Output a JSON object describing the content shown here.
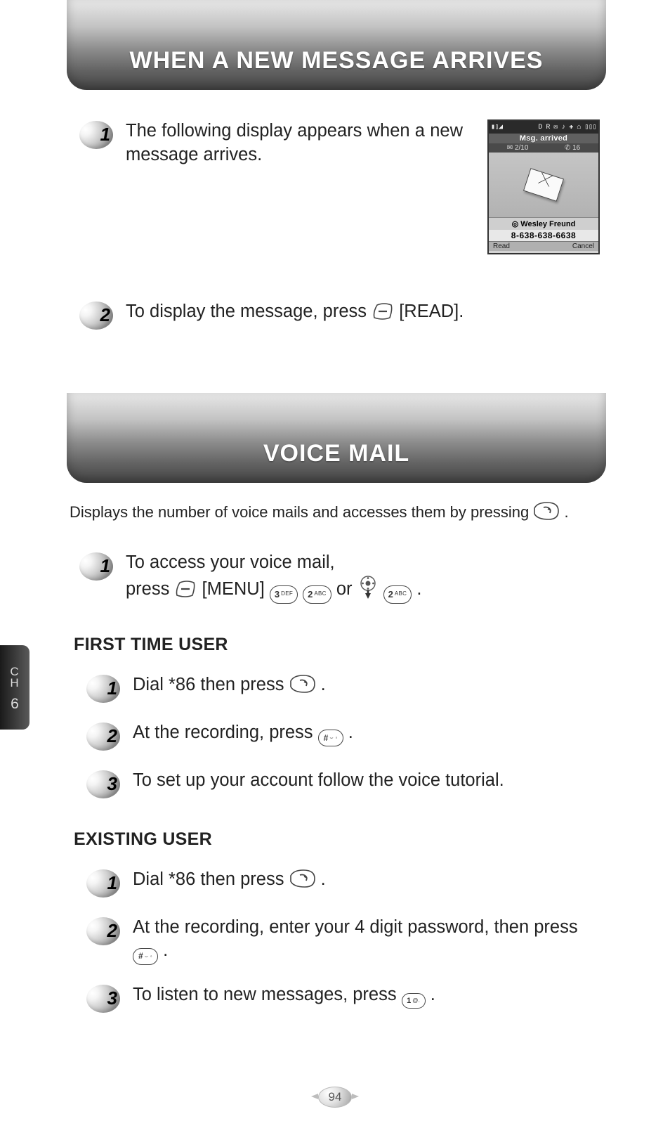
{
  "section1": {
    "title": "WHEN A NEW MESSAGE ARRIVES",
    "steps": [
      {
        "num": "1",
        "text": "The following display appears when a new message arrives."
      },
      {
        "num": "2",
        "text_before": "To display the message, press ",
        "read_label": " [READ]."
      }
    ]
  },
  "phone": {
    "status_left": "▮▯◢",
    "status_right": "D R ✉ ♪ ✚ ⌂ ▯▯▯",
    "banner": "Msg. arrived",
    "count_msg": "✉ 2/10",
    "count_vm": "✆ 16",
    "sender": "◎ Wesley Freund",
    "number": "8-638-638-6638",
    "soft_left": "Read",
    "soft_right": "Cancel"
  },
  "section2": {
    "title": "VOICE MAIL",
    "intro_before": "Displays the number of voice mails and accesses them by pressing ",
    "intro_after": " .",
    "access": {
      "num": "1",
      "line1": "To access your voice mail,",
      "line2_a": "press ",
      "line2_menu": "[MENU] ",
      "line2_or": " or ",
      "line2_end": "."
    },
    "first_time_heading": "FIRST TIME USER",
    "first_time": [
      {
        "num": "1",
        "before": "Dial *86 then press ",
        "after": " ."
      },
      {
        "num": "2",
        "before": "At the recording, press ",
        "after": "."
      },
      {
        "num": "3",
        "text": "To set up your account follow the voice tutorial."
      }
    ],
    "existing_heading": "EXISTING USER",
    "existing": [
      {
        "num": "1",
        "before": "Dial *86 then press ",
        "after": " ."
      },
      {
        "num": "2",
        "before": "At the recording, enter your 4 digit password, then press ",
        "after": "."
      },
      {
        "num": "3",
        "before": "To listen to new messages, press ",
        "after": "."
      }
    ]
  },
  "keys": {
    "three": "3",
    "three_sup": "DEF",
    "two": "2",
    "two_sup": "ABC",
    "hash": "#",
    "hash_sup": "⌣ ◦",
    "one": "1",
    "one_sup": "@."
  },
  "chapter": {
    "label": "C\nH",
    "num": "6"
  },
  "page_number": "94"
}
